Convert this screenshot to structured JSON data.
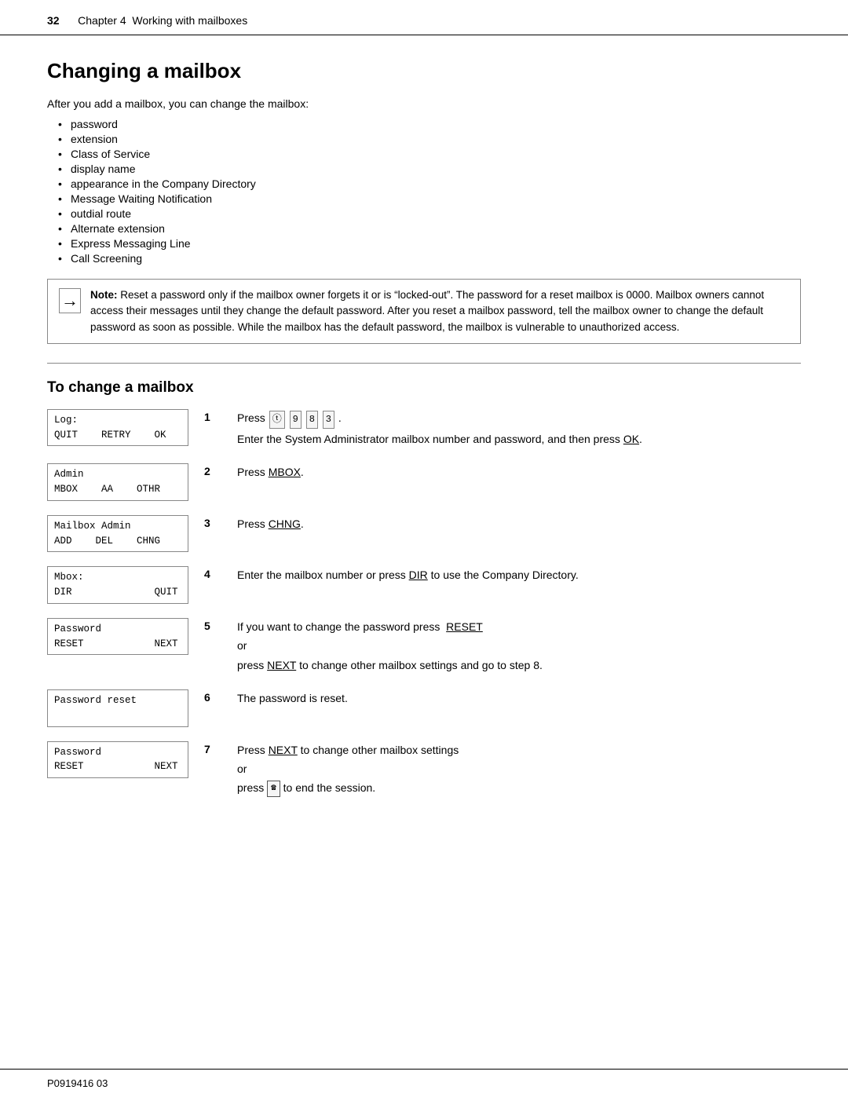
{
  "header": {
    "page_number": "32",
    "chapter": "Chapter 4",
    "title": "Working with mailboxes"
  },
  "page_heading": "Changing a mailbox",
  "intro": {
    "text": "After you add a mailbox, you can change the mailbox:"
  },
  "bullet_items": [
    "password",
    "extension",
    "Class of Service",
    "display name",
    "appearance in the Company Directory",
    "Message Waiting Notification",
    "outdial route",
    "Alternate extension",
    "Express Messaging Line",
    "Call Screening"
  ],
  "note": {
    "label": "Note:",
    "text": "Reset a password only if the mailbox owner forgets it or is “locked-out”. The password for a reset mailbox is 0000. Mailbox owners cannot access their messages until they change the default password. After you reset a mailbox password, tell the mailbox owner to change the default password as soon as possible. While the mailbox has the default password, the mailbox is vulnerable to unauthorized access."
  },
  "section2_heading": "To change a mailbox",
  "steps": [
    {
      "number": "1",
      "screen_lines": [
        "Log:",
        "QUIT    RETRY    OK"
      ],
      "text": "Press ⓣ 9 8 3 .",
      "sub_text": "Enter the System Administrator mailbox number and password, and then press OK."
    },
    {
      "number": "2",
      "screen_lines": [
        "Admin",
        "MBOX    AA    OTHR"
      ],
      "text": "Press MBOX."
    },
    {
      "number": "3",
      "screen_lines": [
        "Mailbox Admin",
        "ADD    DEL    CHNG"
      ],
      "text": "Press CHNG."
    },
    {
      "number": "4",
      "screen_lines": [
        "Mbox:",
        "DIR              QUIT"
      ],
      "text": "Enter the mailbox number or press DIR to use the Company Directory."
    },
    {
      "number": "5",
      "screen_lines": [
        "Password",
        "RESET            NEXT"
      ],
      "text": "If you want to change the password press  RESET",
      "sub_text": "or",
      "sub_text2": "press NEXT to change other mailbox settings and go to step 8."
    },
    {
      "number": "6",
      "screen_lines": [
        "Password reset",
        ""
      ],
      "text": "The password is reset."
    },
    {
      "number": "7",
      "screen_lines": [
        "Password",
        "RESET            NEXT"
      ],
      "text": "Press NEXT to change other mailbox settings",
      "sub_text": "or",
      "sub_text2": "press ✉ to end the session."
    }
  ],
  "footer": {
    "text": "P0919416 03"
  }
}
